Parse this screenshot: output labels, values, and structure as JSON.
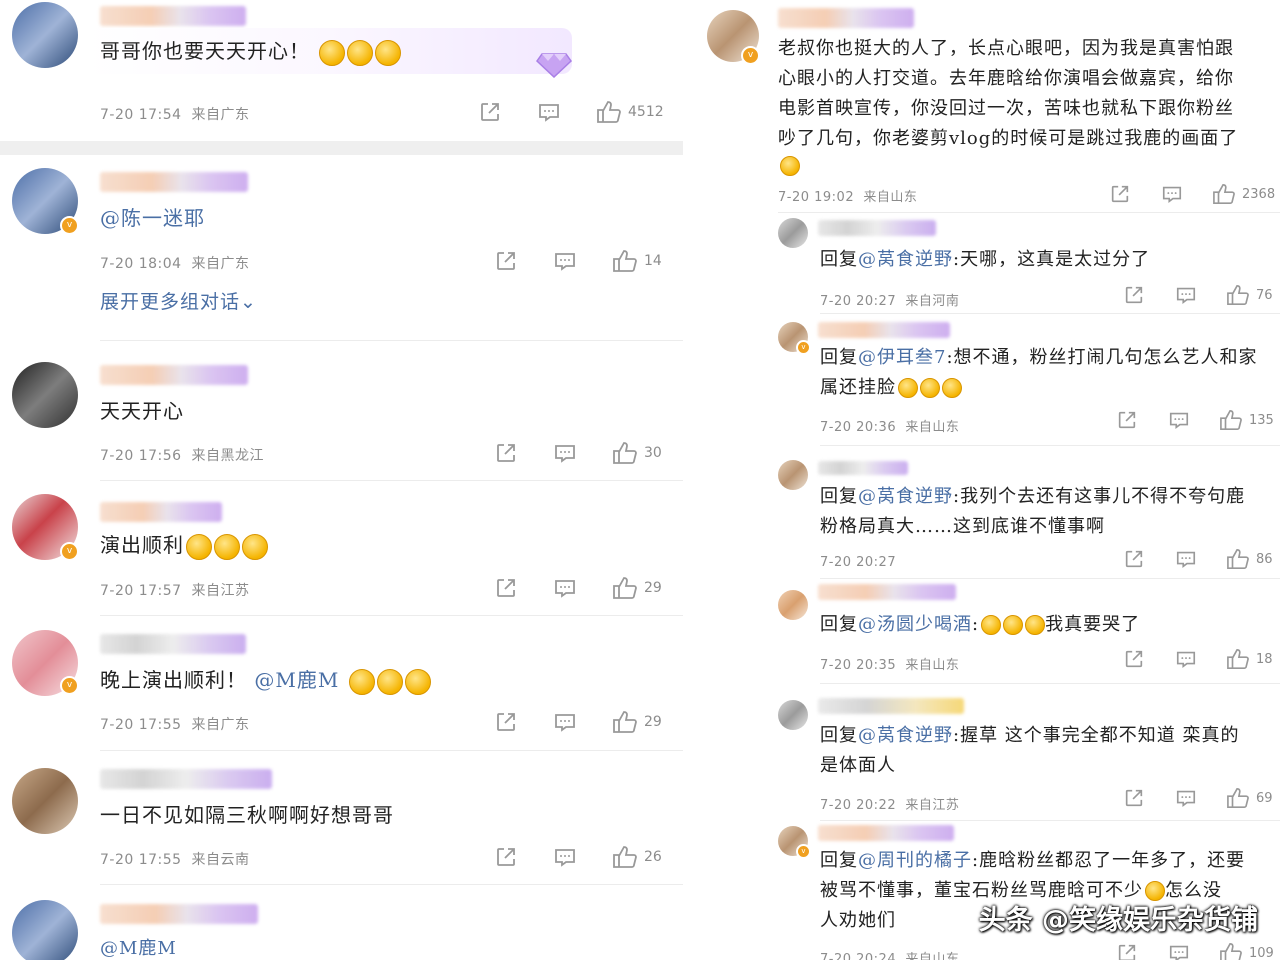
{
  "left": {
    "comments": [
      {
        "text": "哥哥你也要天天开心！",
        "time": "7-20 17:54",
        "location": "来自广东",
        "likes": "4512"
      },
      {
        "mention": "@陈一迷耶",
        "time": "7-20 18:04",
        "location": "来自广东",
        "likes": "14",
        "expand": "展开更多组对话"
      },
      {
        "text": "天天开心",
        "time": "7-20 17:56",
        "location": "来自黑龙江",
        "likes": "30"
      },
      {
        "text": "演出顺利",
        "time": "7-20 17:57",
        "location": "来自江苏",
        "likes": "29"
      },
      {
        "text": "晚上演出顺利！",
        "mention": "@M鹿M",
        "time": "7-20 17:55",
        "location": "来自广东",
        "likes": "29"
      },
      {
        "text": "一日不见如隔三秋啊啊好想哥哥",
        "time": "7-20 17:55",
        "location": "来自云南",
        "likes": "26"
      },
      {
        "mention": "@M鹿M"
      }
    ]
  },
  "right": {
    "main": {
      "lines": [
        "老叔你也挺大的人了，长点心眼吧，因为我是真害怕跟",
        "心眼小的人打交道。去年鹿晗给你演唱会做嘉宾，给你",
        "电影首映宣传，你没回过一次，苦味也就私下跟你粉丝",
        "吵了几句，你老婆剪vlog的时候可是跳过我鹿的画面了"
      ],
      "time": "7-20 19:02",
      "location": "来自山东",
      "likes": "2368"
    },
    "replies": [
      {
        "prefix": "回复",
        "mention": "@莴食逆野",
        "text": ":天哪，这真是太过分了",
        "cont": "",
        "time": "7-20 20:27",
        "location": "来自河南",
        "likes": "76"
      },
      {
        "prefix": "回复",
        "mention": "@伊耳叁7",
        "text": ":想不通，粉丝打闹几句怎么艺人和家",
        "cont": "属还挂脸",
        "time": "7-20 20:36",
        "location": "来自山东",
        "likes": "135"
      },
      {
        "prefix": "回复",
        "mention": "@莴食逆野",
        "text": ":我列个去还有这事儿不得不夸句鹿",
        "cont": "粉格局真大……这到底谁不懂事啊",
        "time": "7-20 20:27",
        "location": "",
        "likes": "86"
      },
      {
        "prefix": "回复",
        "mention": "@汤圆少喝酒",
        "text": ":",
        "cont2": "我真要哭了",
        "cont": "",
        "time": "7-20 20:35",
        "location": "来自山东",
        "likes": "18"
      },
      {
        "prefix": "回复",
        "mention": "@莴食逆野",
        "text": ":握草 这个事完全都不知道 栾真的",
        "cont": "是体面人",
        "time": "7-20 20:22",
        "location": "来自江苏",
        "likes": "69"
      },
      {
        "prefix": "回复",
        "mention": "@周刊的橘子",
        "text": ":鹿晗粉丝都忍了一年多了，还要",
        "cont": "被骂不懂事，董宝石粉丝骂鹿晗可不少",
        "cont3": "怎么没",
        "cont4": "人劝她们",
        "time": "7-20 20:24",
        "location": "来自山东",
        "likes": "109"
      }
    ]
  },
  "watermark": "头条 @笑缘娱乐杂货铺",
  "icons": {
    "share": "share-icon",
    "comment": "comment-icon",
    "like": "like-icon"
  }
}
